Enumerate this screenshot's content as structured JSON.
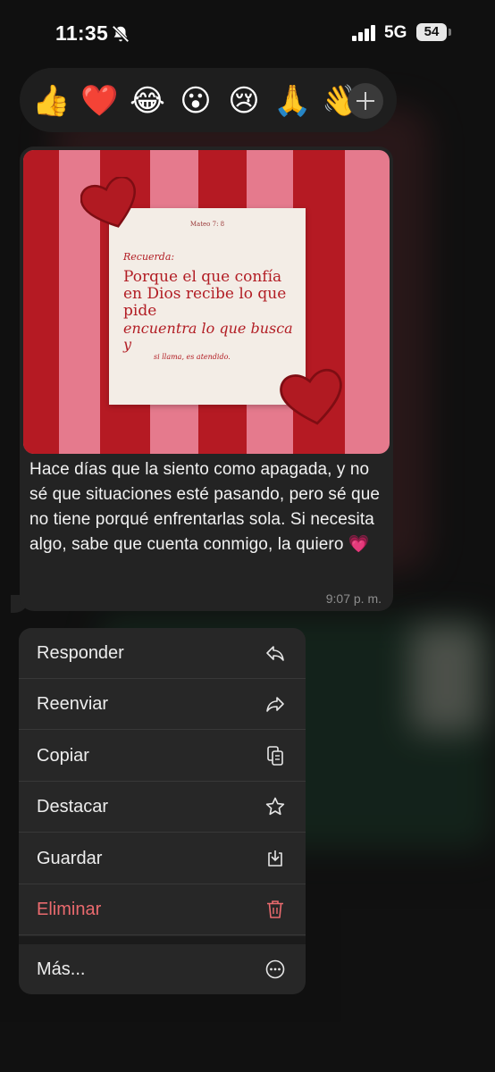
{
  "status_bar": {
    "time": "11:35",
    "network": "5G",
    "battery": "54"
  },
  "reactions": {
    "emojis": [
      {
        "glyph": "👍",
        "name": "thumbs-up"
      },
      {
        "glyph": "❤️",
        "name": "red-heart"
      },
      {
        "glyph": "😂",
        "name": "tears-of-joy"
      },
      {
        "glyph": "😮",
        "name": "surprised"
      },
      {
        "glyph": "😢",
        "name": "crying"
      },
      {
        "glyph": "🙏",
        "name": "praying-hands"
      },
      {
        "glyph": "👋",
        "name": "waving-hand"
      }
    ],
    "more_icon": "plus-icon"
  },
  "message": {
    "image": {
      "reference": "Mateo 7: 8",
      "hint": "Recuerda:",
      "main": "Porque el que confía en Dios recibe lo que pide",
      "italic": "encuentra lo que busca y",
      "small": "si llama, es atendido."
    },
    "text": "Hace días que la siento como apagada, y no sé que situaciones esté pasando, pero sé que no tiene porqué enfrentarlas sola. Si necesita algo, sabe que cuenta conmigo, la quiero 💗",
    "time": "9:07 p. m."
  },
  "menu": {
    "items": [
      {
        "label": "Responder",
        "icon": "reply-icon"
      },
      {
        "label": "Reenviar",
        "icon": "forward-icon"
      },
      {
        "label": "Copiar",
        "icon": "copy-icon"
      },
      {
        "label": "Destacar",
        "icon": "star-icon"
      },
      {
        "label": "Guardar",
        "icon": "save-icon"
      },
      {
        "label": "Eliminar",
        "icon": "trash-icon"
      },
      {
        "label": "Más...",
        "icon": "more-icon"
      }
    ],
    "danger_color": "#ea6a6e"
  }
}
